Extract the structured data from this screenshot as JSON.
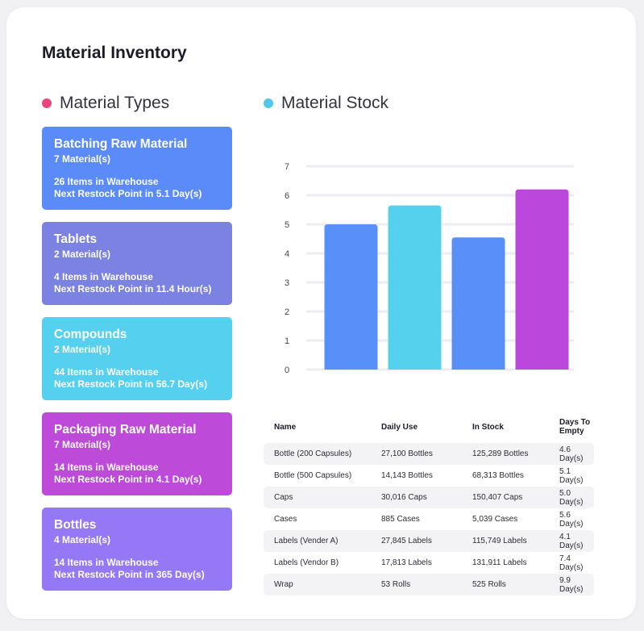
{
  "page": {
    "title": "Material Inventory"
  },
  "colors": {
    "types_dot": "#e8457a",
    "stock_dot": "#4fc8ea",
    "card_blue": "#5a8bf8",
    "card_slate": "#7b82e2",
    "card_cyan": "#55d0ee",
    "card_magenta": "#bd4ad8",
    "card_violet": "#9478f6"
  },
  "material_types": {
    "heading": "Material Types",
    "items": [
      {
        "name": "Batching Raw Material",
        "count": "7 Material(s)",
        "items": "26 Items in Warehouse",
        "restock": "Next Restock Point in 5.1 Day(s)",
        "color": "#5a8bf8"
      },
      {
        "name": "Tablets",
        "count": "2 Material(s)",
        "items": "4 Items in Warehouse",
        "restock": "Next Restock Point in 11.4 Hour(s)",
        "color": "#7b82e2"
      },
      {
        "name": "Compounds",
        "count": "2 Material(s)",
        "items": "44 Items in Warehouse",
        "restock": "Next Restock Point in 56.7 Day(s)",
        "color": "#55d0ee"
      },
      {
        "name": "Packaging Raw Material",
        "count": "7 Material(s)",
        "items": "14 Items in Warehouse",
        "restock": "Next Restock Point in 4.1 Day(s)",
        "color": "#bd4ad8"
      },
      {
        "name": "Bottles",
        "count": "4 Material(s)",
        "items": "14 Items in Warehouse",
        "restock": "Next Restock Point in 365 Day(s)",
        "color": "#9478f6"
      }
    ]
  },
  "material_stock": {
    "heading": "Material Stock"
  },
  "chart_data": {
    "type": "bar",
    "categories": [
      "",
      "",
      "",
      ""
    ],
    "values": [
      5.0,
      5.65,
      4.55,
      6.2
    ],
    "colors": [
      "#588ff9",
      "#55d1ee",
      "#588ff9",
      "#bb47dd"
    ],
    "ylim": [
      0,
      7
    ],
    "yticks": [
      0,
      1,
      2,
      3,
      4,
      5,
      6,
      7
    ],
    "grid": true,
    "xlabel": "",
    "ylabel": "",
    "title": ""
  },
  "table": {
    "headers": [
      "Name",
      "Daily Use",
      "In Stock",
      "Days To Empty"
    ],
    "rows": [
      [
        "Bottle (200 Capsules)",
        "27,100 Bottles",
        "125,289 Bottles",
        "4.6 Day(s)"
      ],
      [
        "Bottle (500 Capsules)",
        "14,143 Bottles",
        "68,313 Bottles",
        "5.1 Day(s)"
      ],
      [
        "Caps",
        "30,016 Caps",
        "150,407 Caps",
        "5.0 Day(s)"
      ],
      [
        "Cases",
        "885 Cases",
        "5,039 Cases",
        "5.6 Day(s)"
      ],
      [
        "Labels (Vender A)",
        "27,845 Labels",
        "115,749 Labels",
        "4.1 Day(s)"
      ],
      [
        "Labels (Vendor B)",
        "17,813 Labels",
        "131,911 Labels",
        "7.4 Day(s)"
      ],
      [
        "Wrap",
        "53 Rolls",
        "525 Rolls",
        "9.9 Day(s)"
      ]
    ]
  }
}
